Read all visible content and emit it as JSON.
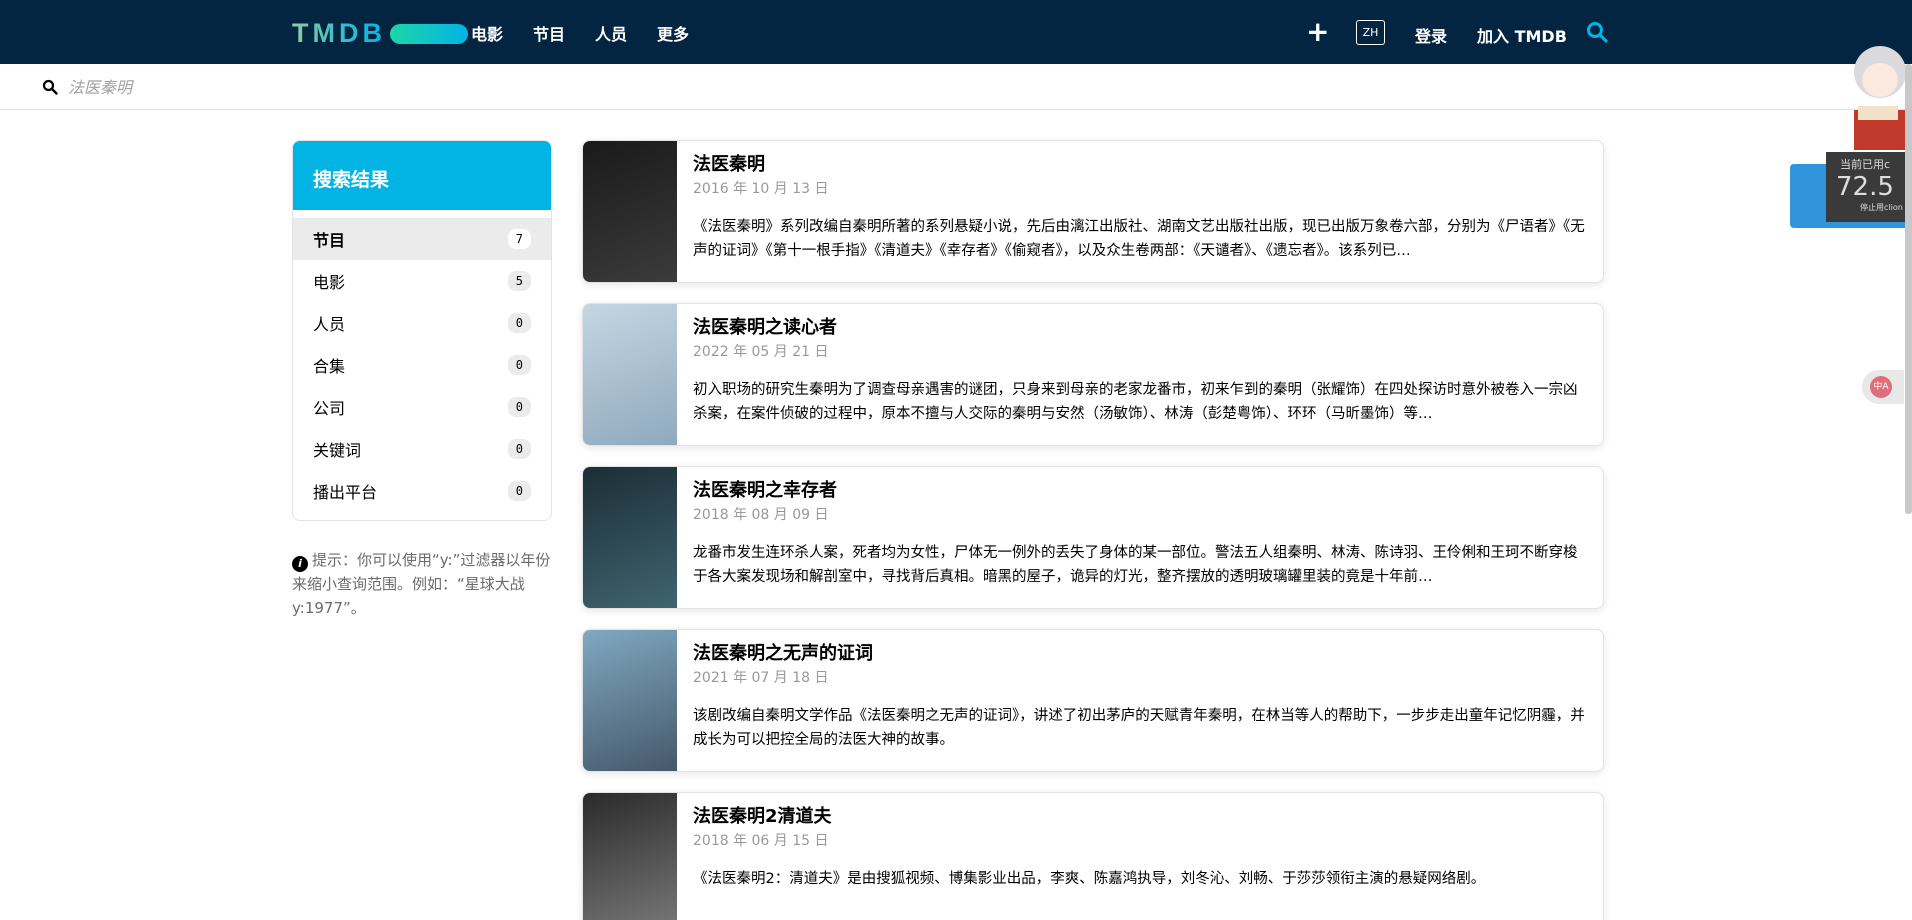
{
  "header": {
    "logo": "TMDB",
    "nav": [
      "电影",
      "节目",
      "人员",
      "更多"
    ],
    "plus": "+",
    "lang": "ZH",
    "login": "登录",
    "join": "加入 TMDB",
    "colors": {
      "bg": "#032541",
      "accent": "#01b4e4"
    }
  },
  "search": {
    "placeholder": "法医秦明"
  },
  "sidebar": {
    "title": "搜索结果",
    "items": [
      {
        "label": "节目",
        "count": "7",
        "active": true
      },
      {
        "label": "电影",
        "count": "5"
      },
      {
        "label": "人员",
        "count": "0"
      },
      {
        "label": "合集",
        "count": "0"
      },
      {
        "label": "公司",
        "count": "0"
      },
      {
        "label": "关键词",
        "count": "0"
      },
      {
        "label": "播出平台",
        "count": "0"
      }
    ]
  },
  "tip": "提示：你可以使用“y:”过滤器以年份来缩小查询范围。例如：“星球大战 y:1977”。",
  "results": [
    {
      "title": "法医秦明",
      "date": "2016 年 10 月 13 日",
      "overview": "《法医秦明》系列改编自秦明所著的系列悬疑小说，先后由漓江出版社、湖南文艺出版社出版，现已出版万象卷六部，分别为《尸语者》《无声的证词》《第十一根手指》《清道夫》《幸存者》《偷窥者》，以及众生卷两部：《天谴者》、《遗忘者》。该系列已…",
      "poster_colors": [
        "#1a1a1a",
        "#3b3b3b"
      ]
    },
    {
      "title": "法医秦明之读心者",
      "date": "2022 年 05 月 21 日",
      "overview": "初入职场的研究生秦明为了调查母亲遇害的谜团，只身来到母亲的老家龙番市，初来乍到的秦明（张耀饰）在四处探访时意外被卷入一宗凶杀案，在案件侦破的过程中，原本不擅与人交际的秦明与安然（汤敏饰）、林涛（彭楚粤饰）、环环（马昕墨饰）等…",
      "poster_colors": [
        "#c5d6e3",
        "#8fa9bd"
      ]
    },
    {
      "title": "法医秦明之幸存者",
      "date": "2018 年 08 月 09 日",
      "overview": "龙番市发生连环杀人案，死者均为女性，尸体无一例外的丢失了身体的某一部位。警法五人组秦明、林涛、陈诗羽、王伶俐和王珂不断穿梭于各大案发现场和解剖室中，寻找背后真相。暗黑的屋子，诡异的灯光，整齐摆放的透明玻璃罐里装的竟是十年前…",
      "poster_colors": [
        "#1c2e36",
        "#3f6470"
      ]
    },
    {
      "title": "法医秦明之无声的证词",
      "date": "2021 年 07 月 18 日",
      "overview": "该剧改编自秦明文学作品《法医秦明之无声的证词》，讲述了初出茅庐的天赋青年秦明，在林当等人的帮助下，一步步走出童年记忆阴霾，并成长为可以把控全局的法医大神的故事。",
      "poster_colors": [
        "#7fa9c2",
        "#46586a"
      ]
    },
    {
      "title": "法医秦明2清道夫",
      "date": "2018 年 06 月 15 日",
      "overview": "《法医秦明2：清道夫》是由搜狐视频、博集影业出品，李爽、陈嘉鸿执导，刘冬沁、刘畅、于莎莎领衔主演的悬疑网络剧。",
      "poster_colors": [
        "#2a2a2a",
        "#7a7a7a"
      ]
    }
  ],
  "widget": {
    "line1": "当前已用c",
    "value": "72.5",
    "line3": "停止用clion"
  },
  "translate": "中A"
}
